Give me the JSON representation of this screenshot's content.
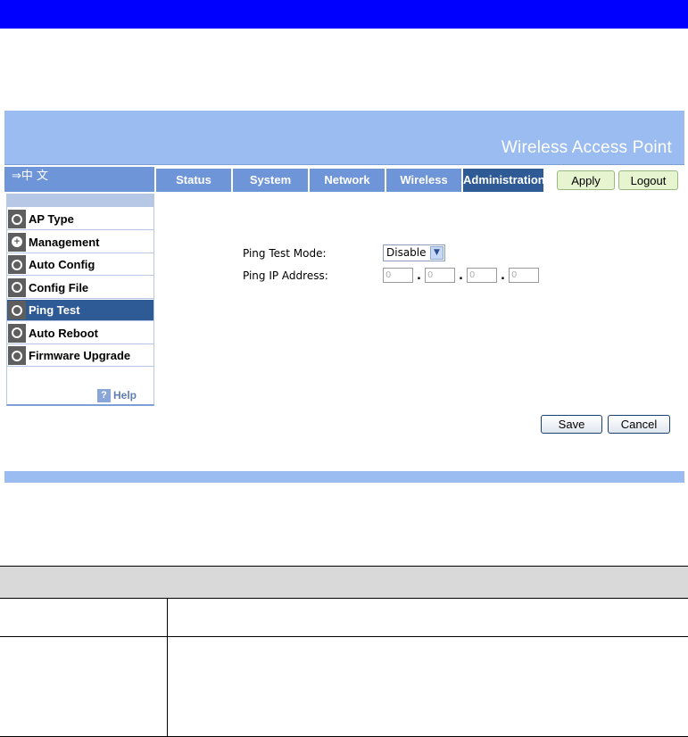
{
  "header": {
    "title": "Wireless Access Point"
  },
  "language_switch": "⇒中 文",
  "tabs": [
    {
      "label": "Status"
    },
    {
      "label": "System"
    },
    {
      "label": "Network"
    },
    {
      "label": "Wireless"
    },
    {
      "label": "Administration",
      "active": true
    }
  ],
  "nav_buttons": {
    "apply": "Apply",
    "logout": "Logout"
  },
  "sidebar": {
    "items": [
      {
        "label": "AP Type",
        "icon": "circle-icon"
      },
      {
        "label": "Management",
        "icon": "plus-icon"
      },
      {
        "label": "Auto Config",
        "icon": "circle-icon"
      },
      {
        "label": "Config File",
        "icon": "circle-icon"
      },
      {
        "label": "Ping Test",
        "icon": "circle-icon",
        "active": true
      },
      {
        "label": "Auto Reboot",
        "icon": "circle-icon"
      },
      {
        "label": "Firmware Upgrade",
        "icon": "circle-icon"
      }
    ],
    "help_label": "Help",
    "help_icon_glyph": "?"
  },
  "form": {
    "ping_mode_label": "Ping Test Mode:",
    "ping_mode_value": "Disable",
    "ip_label": "Ping IP Address:",
    "ip_octets": [
      "0",
      "0",
      "0",
      "0"
    ],
    "save_label": "Save",
    "cancel_label": "Cancel"
  },
  "colors": {
    "top_bar": "#0000ff",
    "header_bg": "#9bbcf0",
    "tab_bg": "#6f95d9",
    "tab_active": "#2e5a96",
    "button_green": "#e6f5d0"
  }
}
